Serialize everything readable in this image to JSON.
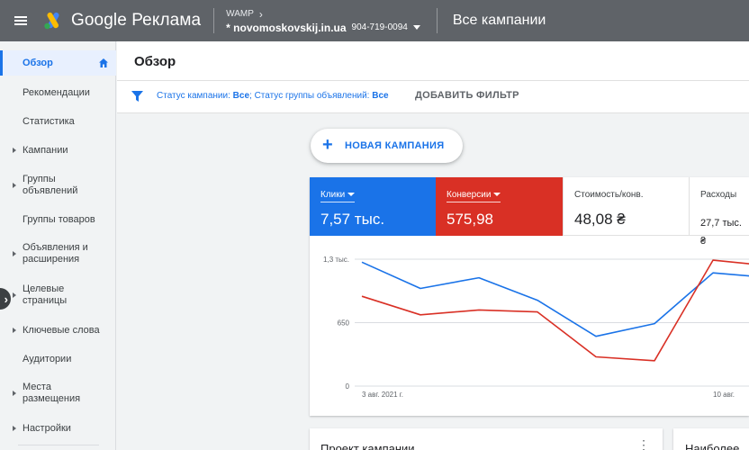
{
  "header": {
    "logo_text": "Google Реклама",
    "account_label": "WAMP",
    "account_name": "* novomoskovskij.in.ua",
    "account_id": "904-719-0094",
    "page_context": "Все кампании"
  },
  "sidebar": {
    "items": [
      {
        "label": "Обзор",
        "active": true,
        "expandable": false
      },
      {
        "label": "Рекомендации",
        "expandable": false
      },
      {
        "label": "Статистика",
        "expandable": false
      },
      {
        "label": "Кампании",
        "expandable": true
      },
      {
        "label": "Группы объявлений",
        "expandable": true
      },
      {
        "label": "Группы товаров",
        "expandable": false
      },
      {
        "label": "Объявления и расширения",
        "expandable": true
      },
      {
        "label": "Целевые страницы",
        "expandable": true
      },
      {
        "label": "Ключевые слова",
        "expandable": true
      },
      {
        "label": "Аудитории",
        "expandable": false
      },
      {
        "label": "Места размещения",
        "expandable": true
      },
      {
        "label": "Настройки",
        "expandable": true
      }
    ]
  },
  "main": {
    "title": "Обзор",
    "filter": {
      "status_campaign_label": "Статус кампании: ",
      "status_campaign_value": "Все",
      "separator": "; ",
      "status_group_label": "Статус группы объявлений: ",
      "status_group_value": "Все",
      "add_filter": "ДОБАВИТЬ ФИЛЬТР"
    },
    "new_campaign_label": "НОВАЯ КАМПАНИЯ"
  },
  "metrics": [
    {
      "label": "Клики",
      "value": "7,57 тыс.",
      "color": "#1a73e8"
    },
    {
      "label": "Конверсии",
      "value": "575,98",
      "color": "#d93025"
    },
    {
      "label": "Стоимость/конв.",
      "value": "48,08 ₴"
    },
    {
      "label": "Расходы",
      "value": "27,7 тыс. ₴"
    }
  ],
  "chart_data": {
    "type": "line",
    "y_ticks": [
      "1,3 тыс.",
      "650",
      "0"
    ],
    "ylim": [
      0,
      1300
    ],
    "x_tick_labels": [
      "3 авг. 2021 г.",
      "10 авг."
    ],
    "series": [
      {
        "name": "Клики",
        "color": "#1a73e8",
        "values": [
          1270,
          1000,
          1110,
          880,
          510,
          640,
          1160,
          1110
        ]
      },
      {
        "name": "Конверсии",
        "color": "#d93025",
        "values": [
          920,
          730,
          780,
          760,
          300,
          260,
          1290,
          1230
        ]
      }
    ],
    "grid": true
  },
  "bottom_cards": {
    "card1_title": "Проект кампании",
    "card2_title": "Наиболее"
  }
}
